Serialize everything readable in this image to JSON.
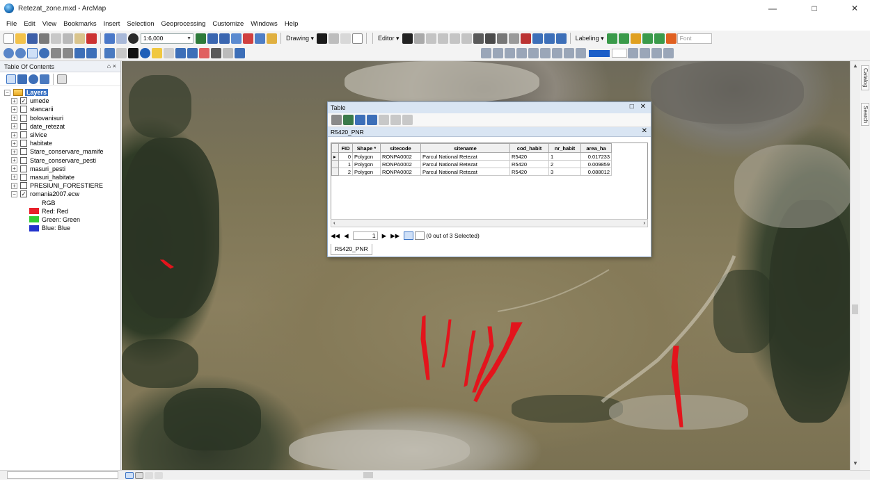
{
  "window": {
    "title": "Retezat_zone.mxd - ArcMap",
    "minimize": "—",
    "maximize": "□",
    "close": "✕"
  },
  "menu": [
    "File",
    "Edit",
    "View",
    "Bookmarks",
    "Insert",
    "Selection",
    "Geoprocessing",
    "Customize",
    "Windows",
    "Help"
  ],
  "toolbar": {
    "scale": "1:6,000",
    "drawing_label": "Drawing ▾",
    "editor_label": "Editor ▾",
    "labeling_label": "Labeling ▾",
    "font_box": "Font"
  },
  "toc": {
    "title": "Table Of Contents",
    "pin": "⌂ ×",
    "root_label": "Layers",
    "layers": [
      {
        "name": "umede",
        "checked": true,
        "expander": "+"
      },
      {
        "name": "stancarii",
        "checked": false,
        "expander": "+"
      },
      {
        "name": "bolovanisuri",
        "checked": false,
        "expander": "+"
      },
      {
        "name": "date_retezat",
        "checked": false,
        "expander": "+"
      },
      {
        "name": "silvice",
        "checked": false,
        "expander": "+"
      },
      {
        "name": "habitate",
        "checked": false,
        "expander": "+"
      },
      {
        "name": "Stare_conservare_mamife",
        "checked": false,
        "expander": "+"
      },
      {
        "name": "Stare_conservare_pesti",
        "checked": false,
        "expander": "+"
      },
      {
        "name": "masuri_pesti",
        "checked": false,
        "expander": "+"
      },
      {
        "name": "masuri_habitate",
        "checked": false,
        "expander": "+"
      },
      {
        "name": "PRESIUNI_FORESTIERE",
        "checked": false,
        "expander": "+"
      },
      {
        "name": "romania2007.ecw",
        "checked": true,
        "expander": "−"
      }
    ],
    "rgb_label": "RGB",
    "bands": [
      {
        "label": "Red:  Red",
        "color": "#e8202a"
      },
      {
        "label": "Green:  Green",
        "color": "#33cc33"
      },
      {
        "label": "Blue:  Blue",
        "color": "#2233cc"
      }
    ]
  },
  "table_window": {
    "title": "Table",
    "controls": "□ ✕",
    "tab_name": "R5420_PNR",
    "tab_close": "✕",
    "columns": [
      "FID",
      "Shape *",
      "sitecode",
      "sitename",
      "cod_habit",
      "nr_habit",
      "area_ha"
    ],
    "rows": [
      [
        "0",
        "Polygon",
        "RONPA0002",
        "Parcul National Retezat",
        "R5420",
        "1",
        "0.017233"
      ],
      [
        "1",
        "Polygon",
        "RONPA0002",
        "Parcul National Retezat",
        "R5420",
        "2",
        "0.009859"
      ],
      [
        "2",
        "Polygon",
        "RONPA0002",
        "Parcul National Retezat",
        "R5420",
        "3",
        "0.088012"
      ]
    ],
    "nav_first": "◀◀",
    "nav_prev": "◀",
    "record": "1",
    "nav_next": "▶",
    "nav_last": "▶▶",
    "selection_status": "(0 out of 3 Selected)",
    "bottom_tab": "R5420_PNR"
  },
  "side_tabs": [
    "Catalog",
    "Search"
  ],
  "colors": {
    "accent": "#3b73c4",
    "feature_red": "#e3141c"
  }
}
